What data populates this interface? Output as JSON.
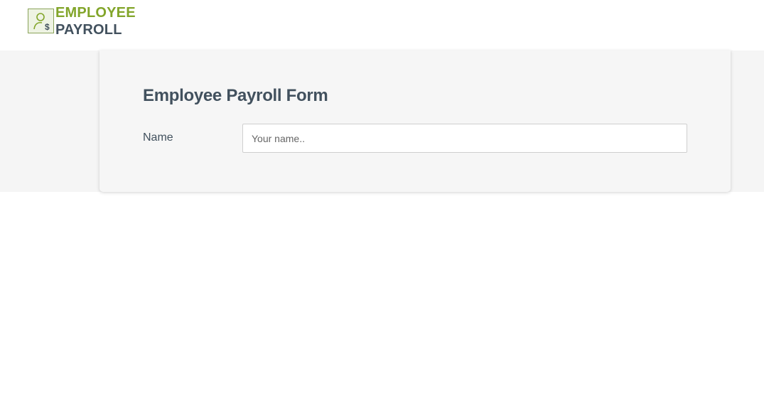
{
  "header": {
    "logo_icon": "employee-payroll-logo-icon",
    "logo_line1": "EMPLOYEE",
    "logo_line2": "PAYROLL",
    "brand_green": "#82a52a",
    "brand_dark": "#42515e"
  },
  "form": {
    "title": "Employee Payroll Form",
    "fields": {
      "name": {
        "label": "Name",
        "placeholder": "Your name..",
        "value": ""
      }
    }
  }
}
